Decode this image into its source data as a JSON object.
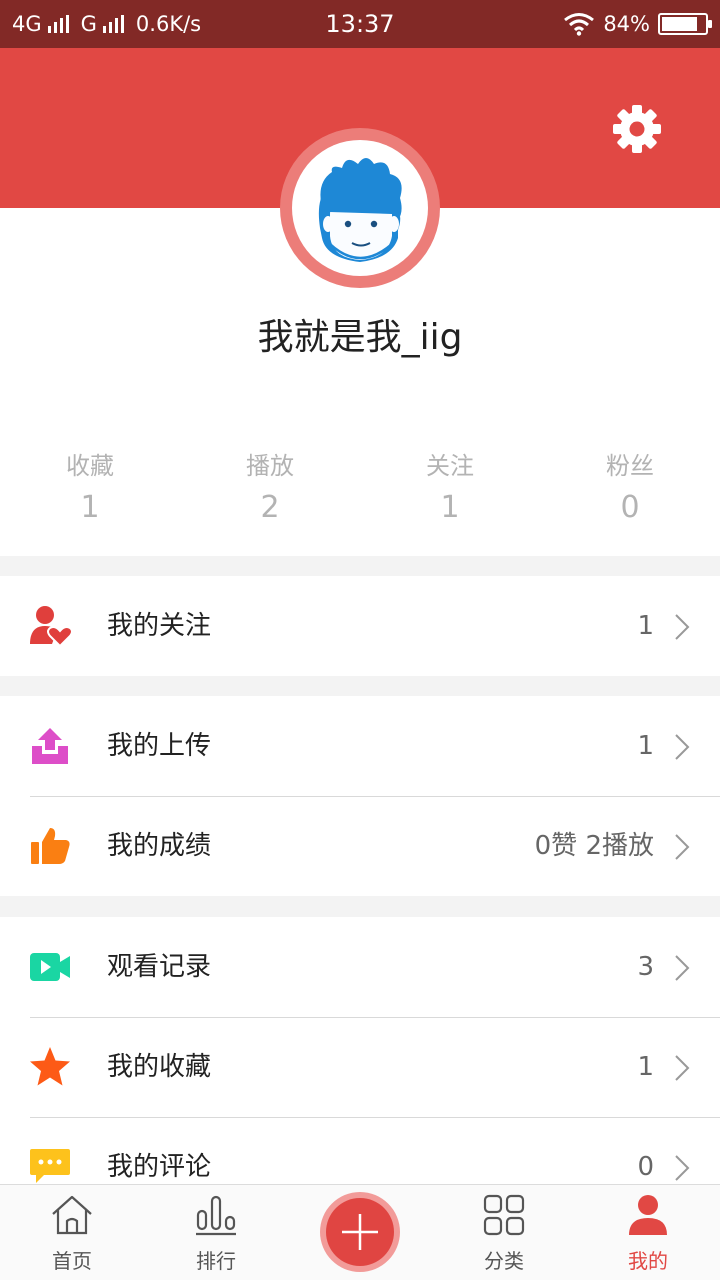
{
  "status_bar": {
    "network1": "4G",
    "network2": "G",
    "speed": "0.6K/s",
    "time": "13:37",
    "battery": "84%",
    "battery_level": 0.84
  },
  "profile": {
    "username": "我就是我_iig",
    "stats": [
      {
        "label": "收藏",
        "value": "1"
      },
      {
        "label": "播放",
        "value": "2"
      },
      {
        "label": "关注",
        "value": "1"
      },
      {
        "label": "粉丝",
        "value": "0"
      }
    ]
  },
  "menu": [
    [
      {
        "icon": "follow-heart-icon",
        "label": "我的关注",
        "value": "1"
      }
    ],
    [
      {
        "icon": "upload-icon",
        "label": "我的上传",
        "value": "1"
      },
      {
        "icon": "thumbs-up-icon",
        "label": "我的成绩",
        "value": "0赞 2播放"
      }
    ],
    [
      {
        "icon": "video-camera-icon",
        "label": "观看记录",
        "value": "3"
      },
      {
        "icon": "star-icon",
        "label": "我的收藏",
        "value": "1"
      },
      {
        "icon": "comment-icon",
        "label": "我的评论",
        "value": "0"
      }
    ]
  ],
  "tabbar": {
    "tabs": [
      {
        "icon": "home-icon",
        "label": "首页"
      },
      {
        "icon": "ranking-icon",
        "label": "排行"
      },
      {
        "icon": "grid-icon",
        "label": "分类"
      },
      {
        "icon": "person-icon",
        "label": "我的",
        "active": true
      }
    ],
    "add_icon": "plus-icon"
  },
  "colors": {
    "status_bar": "#822926",
    "header": "#e14844",
    "accent": "#e14844",
    "upload": "#dd4ec8",
    "thumbs": "#fa7f12",
    "video": "#1ad6a3",
    "star": "#fd5a16",
    "comment": "#fdc21c"
  }
}
